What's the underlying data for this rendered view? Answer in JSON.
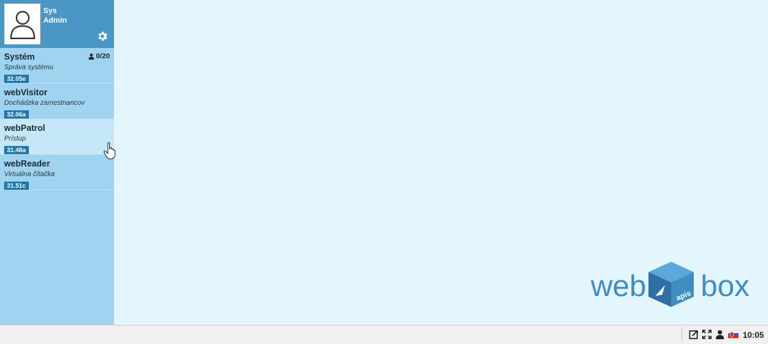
{
  "user": {
    "first": "Sys",
    "last": "Admin"
  },
  "apps": [
    {
      "title": "Systém",
      "subtitle": "Správa systému",
      "version": "32.05e",
      "count": "0/20"
    },
    {
      "title": "webVisitor",
      "subtitle": "Dochádzka zamestnancov",
      "version": "32.06a"
    },
    {
      "title": "webPatrol",
      "subtitle": "Prístup",
      "version": "31.48a"
    },
    {
      "title": "webReader",
      "subtitle": "Virtuálna čítačka",
      "version": "31.51c"
    }
  ],
  "logo": {
    "left": "web",
    "right": "box",
    "badge": "apis"
  },
  "taskbar": {
    "time": "10:05"
  },
  "colors": {
    "sidebar": "#9fd3ef",
    "header": "#4a97c6",
    "badge": "#1f78ad",
    "logo": "#3f8dc3"
  }
}
